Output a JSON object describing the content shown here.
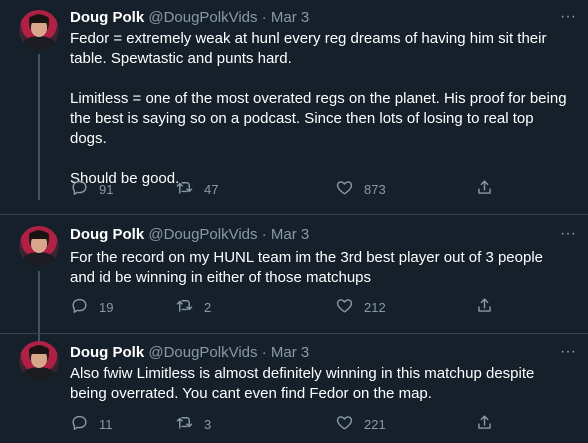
{
  "tweets": [
    {
      "author": "Doug Polk",
      "handle": "@DougPolkVids",
      "separator": "·",
      "date": "Mar 3",
      "more": "···",
      "paragraphs": [
        "Fedor = extremely weak at hunl every reg dreams of having him sit their table. Spewtastic and punts hard.",
        "Limitless = one of the most overated regs on the planet. His proof for being the best is saying so on a podcast. Since then lots of losing to real top dogs.",
        "Should be good."
      ],
      "replies": "91",
      "retweets": "47",
      "likes": "873"
    },
    {
      "author": "Doug Polk",
      "handle": "@DougPolkVids",
      "separator": "·",
      "date": "Mar 3",
      "more": "···",
      "paragraphs": [
        "For the record on my HUNL team im the 3rd best player out of 3 people and id be winning in either of those matchups"
      ],
      "replies": "19",
      "retweets": "2",
      "likes": "212"
    },
    {
      "author": "Doug Polk",
      "handle": "@DougPolkVids",
      "separator": "·",
      "date": "Mar 3",
      "more": "···",
      "paragraphs": [
        "Also fwiw Limitless is almost definitely winning in this matchup despite being overrated. You cant even find Fedor on the map."
      ],
      "replies": "11",
      "retweets": "3",
      "likes": "221"
    }
  ],
  "icons": {
    "reply": "reply-icon",
    "retweet": "retweet-icon",
    "like": "heart-icon",
    "share": "share-icon",
    "more": "more-icon"
  },
  "colors": {
    "background": "#15202b",
    "text": "#ffffff",
    "secondary": "#8899a6",
    "divider": "#38444d",
    "thread_line": "#3d5466"
  }
}
